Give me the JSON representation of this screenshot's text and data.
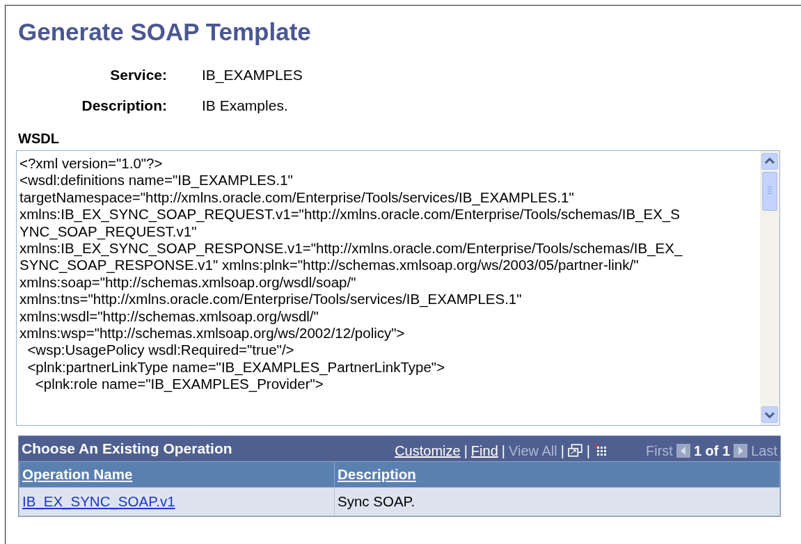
{
  "page": {
    "title": "Generate SOAP Template"
  },
  "fields": [
    {
      "label": "Service:",
      "value": "IB_EXAMPLES"
    },
    {
      "label": "Description:",
      "value": "IB Examples."
    }
  ],
  "wsdl": {
    "label": "WSDL",
    "lines": [
      "<?xml version=\"1.0\"?>",
      "<wsdl:definitions name=\"IB_EXAMPLES.1\"",
      "targetNamespace=\"http://xmlns.oracle.com/Enterprise/Tools/services/IB_EXAMPLES.1\"",
      "xmlns:IB_EX_SYNC_SOAP_REQUEST.v1=\"http://xmlns.oracle.com/Enterprise/Tools/schemas/IB_EX_S",
      "YNC_SOAP_REQUEST.v1\"",
      "xmlns:IB_EX_SYNC_SOAP_RESPONSE.v1=\"http://xmlns.oracle.com/Enterprise/Tools/schemas/IB_EX_",
      "SYNC_SOAP_RESPONSE.v1\" xmlns:plnk=\"http://schemas.xmlsoap.org/ws/2003/05/partner-link/\"",
      "xmlns:soap=\"http://schemas.xmlsoap.org/wsdl/soap/\"",
      "xmlns:tns=\"http://xmlns.oracle.com/Enterprise/Tools/services/IB_EXAMPLES.1\"",
      "xmlns:wsdl=\"http://schemas.xmlsoap.org/wsdl/\"",
      "xmlns:wsp=\"http://schemas.xmlsoap.org/ws/2002/12/policy\">",
      "  <wsp:UsagePolicy wsdl:Required=\"true\"/>",
      "  <plnk:partnerLinkType name=\"IB_EXAMPLES_PartnerLinkType\">",
      "    <plnk:role name=\"IB_EXAMPLES_Provider\">"
    ]
  },
  "grid": {
    "title": "Choose An Existing Operation",
    "separators": [
      "|",
      "|",
      "|",
      "|"
    ],
    "links": [
      "Customize",
      "Find"
    ],
    "view_all": "View All",
    "first": "First",
    "count": "1 of 1",
    "last": "Last",
    "columns": [
      "Operation Name",
      "Description"
    ],
    "rows": [
      {
        "operation": "IB_EX_SYNC_SOAP.v1",
        "description": "Sync SOAP."
      }
    ]
  }
}
